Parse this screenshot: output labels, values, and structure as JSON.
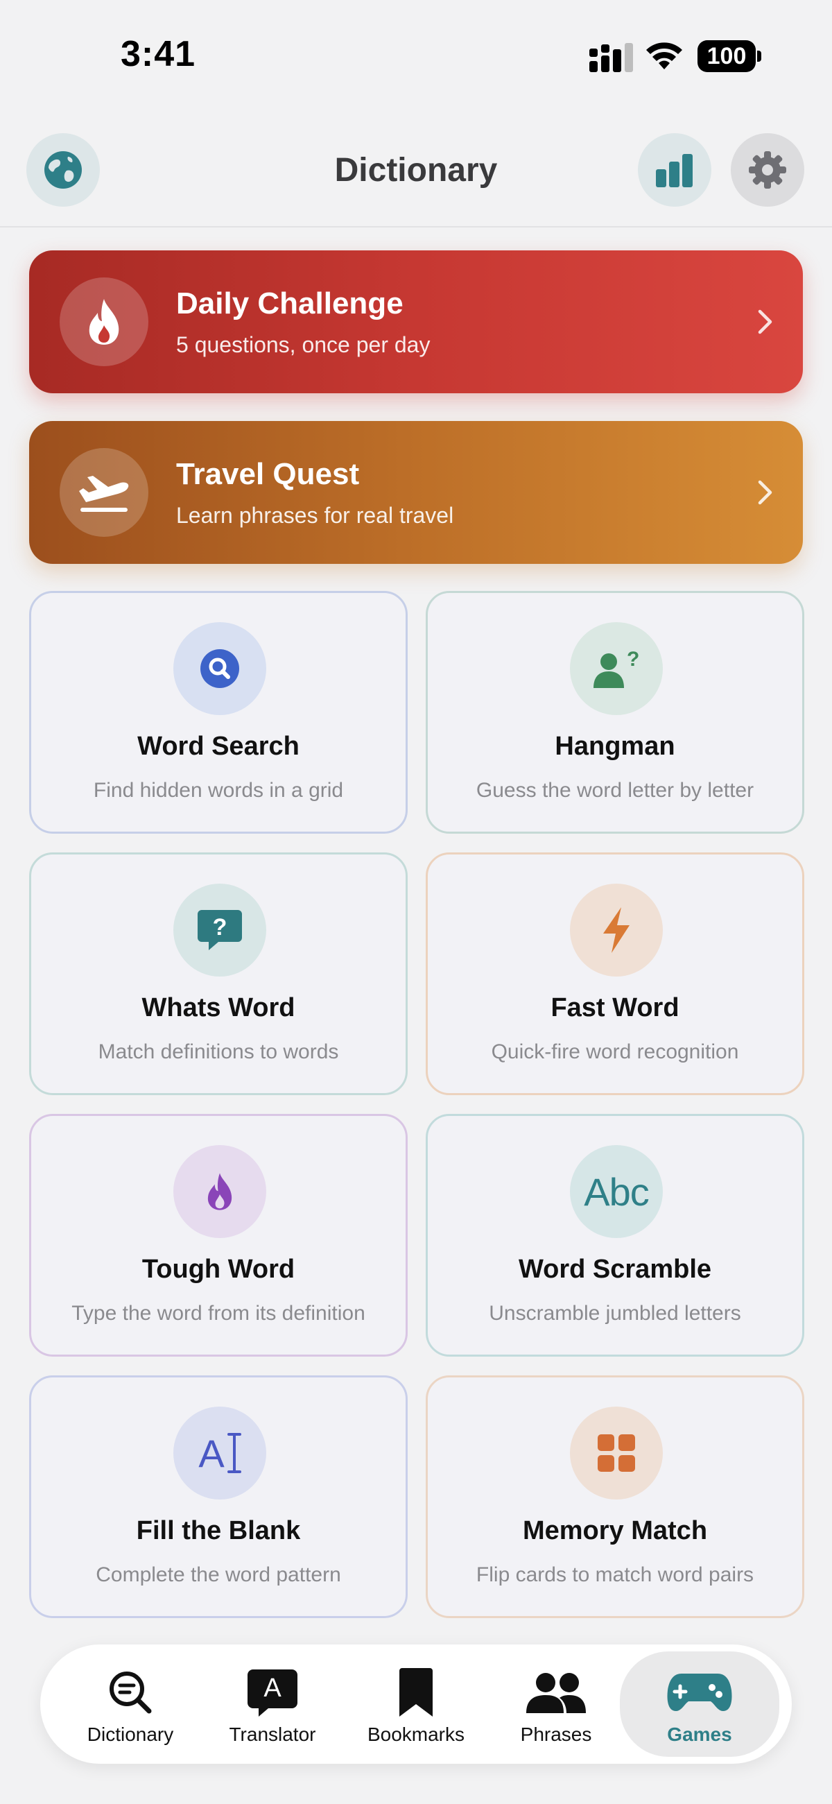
{
  "status": {
    "time": "3:41",
    "battery": "100"
  },
  "header": {
    "title": "Dictionary"
  },
  "banners": [
    {
      "title": "Daily Challenge",
      "subtitle": "5 questions, once per day"
    },
    {
      "title": "Travel Quest",
      "subtitle": "Learn phrases for real travel"
    }
  ],
  "games": [
    {
      "title": "Word Search",
      "subtitle": "Find hidden words in a grid",
      "icon": "magnifier-icon",
      "color": "#3d63c9"
    },
    {
      "title": "Hangman",
      "subtitle": "Guess the word letter by letter",
      "icon": "person-question-icon",
      "color": "#3e8a5a"
    },
    {
      "title": "Whats Word",
      "subtitle": "Match definitions to words",
      "icon": "speech-question-icon",
      "color": "#2e7a80"
    },
    {
      "title": "Fast Word",
      "subtitle": "Quick-fire word recognition",
      "icon": "bolt-icon",
      "color": "#d97a35"
    },
    {
      "title": "Tough Word",
      "subtitle": "Type the word from its definition",
      "icon": "flame-icon",
      "color": "#8a45b8"
    },
    {
      "title": "Word Scramble",
      "subtitle": "Unscramble jumbled letters",
      "icon": "abc-icon",
      "icon_text": "Abc",
      "color": "#2f8088"
    },
    {
      "title": "Fill the Blank",
      "subtitle": "Complete the word pattern",
      "icon": "text-cursor-icon",
      "icon_text": "A",
      "color": "#4a58c4"
    },
    {
      "title": "Memory Match",
      "subtitle": "Flip cards to match word pairs",
      "icon": "grid-cards-icon",
      "color": "#d46e36"
    }
  ],
  "tabs": [
    {
      "label": "Dictionary",
      "icon": "search-text-icon"
    },
    {
      "label": "Translator",
      "icon": "translate-bubble-icon",
      "icon_text": "A"
    },
    {
      "label": "Bookmarks",
      "icon": "bookmark-icon"
    },
    {
      "label": "Phrases",
      "icon": "people-icon"
    },
    {
      "label": "Games",
      "icon": "gamepad-icon",
      "active": true
    }
  ],
  "colors": {
    "accent": "#2e7f88",
    "daily": "#c63832",
    "travel": "#bd6f28"
  }
}
